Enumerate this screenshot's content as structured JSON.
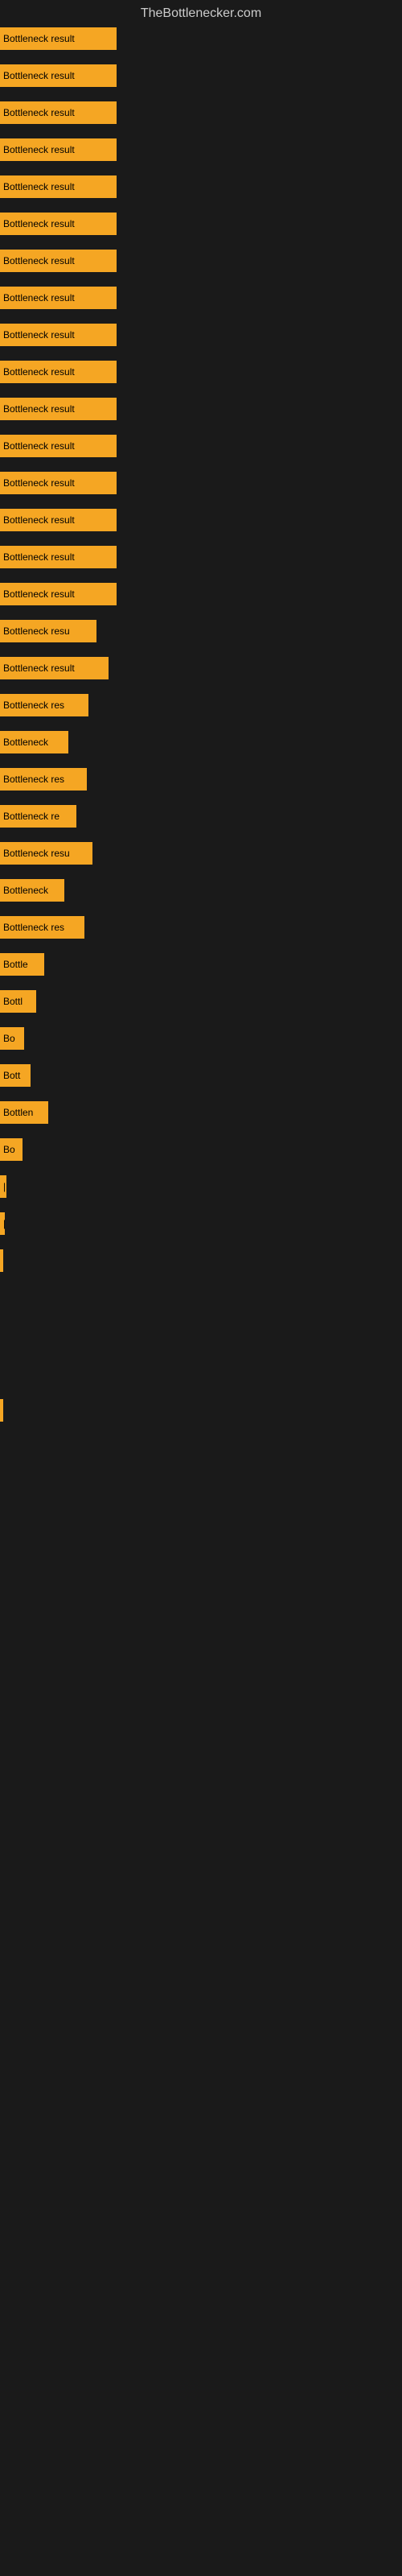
{
  "header": {
    "title": "TheBottlenecker.com"
  },
  "bars": [
    {
      "label": "Bottleneck result",
      "width": 145
    },
    {
      "label": "Bottleneck result",
      "width": 145
    },
    {
      "label": "Bottleneck result",
      "width": 145
    },
    {
      "label": "Bottleneck result",
      "width": 145
    },
    {
      "label": "Bottleneck result",
      "width": 145
    },
    {
      "label": "Bottleneck result",
      "width": 145
    },
    {
      "label": "Bottleneck result",
      "width": 145
    },
    {
      "label": "Bottleneck result",
      "width": 145
    },
    {
      "label": "Bottleneck result",
      "width": 145
    },
    {
      "label": "Bottleneck result",
      "width": 145
    },
    {
      "label": "Bottleneck result",
      "width": 145
    },
    {
      "label": "Bottleneck result",
      "width": 145
    },
    {
      "label": "Bottleneck result",
      "width": 145
    },
    {
      "label": "Bottleneck result",
      "width": 145
    },
    {
      "label": "Bottleneck result",
      "width": 145
    },
    {
      "label": "Bottleneck result",
      "width": 145
    },
    {
      "label": "Bottleneck resu",
      "width": 120
    },
    {
      "label": "Bottleneck result",
      "width": 135
    },
    {
      "label": "Bottleneck res",
      "width": 110
    },
    {
      "label": "Bottleneck",
      "width": 85
    },
    {
      "label": "Bottleneck res",
      "width": 108
    },
    {
      "label": "Bottleneck re",
      "width": 95
    },
    {
      "label": "Bottleneck resu",
      "width": 115
    },
    {
      "label": "Bottleneck",
      "width": 80
    },
    {
      "label": "Bottleneck res",
      "width": 105
    },
    {
      "label": "Bottle",
      "width": 55
    },
    {
      "label": "Bottl",
      "width": 45
    },
    {
      "label": "Bo",
      "width": 30
    },
    {
      "label": "Bott",
      "width": 38
    },
    {
      "label": "Bottlen",
      "width": 60
    },
    {
      "label": "Bo",
      "width": 28
    },
    {
      "label": "|",
      "width": 8
    },
    {
      "label": "|",
      "width": 6
    },
    {
      "label": "",
      "width": 4
    },
    {
      "label": "",
      "width": 0
    },
    {
      "label": "",
      "width": 0
    },
    {
      "label": "",
      "width": 0
    },
    {
      "label": "",
      "width": 0
    },
    {
      "label": "",
      "width": 0
    },
    {
      "label": "",
      "width": 3
    }
  ]
}
